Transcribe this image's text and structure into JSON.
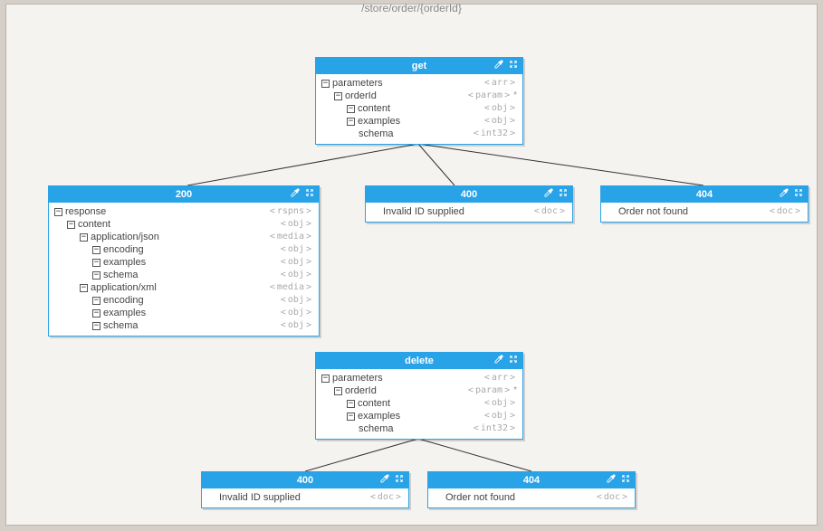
{
  "frameTitle": "/store/order/{orderId}",
  "nodes": {
    "get": {
      "title": "get",
      "rows": [
        {
          "indent": 0,
          "toggle": "-",
          "label": "parameters",
          "type": "arr",
          "star": false
        },
        {
          "indent": 1,
          "toggle": "-",
          "label": "orderId",
          "type": "param",
          "star": true
        },
        {
          "indent": 2,
          "toggle": "-",
          "label": "content",
          "type": "obj",
          "star": false
        },
        {
          "indent": 2,
          "toggle": "-",
          "label": "examples",
          "type": "obj",
          "star": false
        },
        {
          "indent": 2,
          "toggle": "",
          "label": "schema",
          "type": "int32",
          "star": false
        }
      ]
    },
    "r200": {
      "title": "200",
      "rows": [
        {
          "indent": 0,
          "toggle": "-",
          "label": "response",
          "type": "rspns",
          "star": false
        },
        {
          "indent": 1,
          "toggle": "-",
          "label": "content",
          "type": "obj",
          "star": false
        },
        {
          "indent": 2,
          "toggle": "-",
          "label": "application/json",
          "type": "media",
          "star": false
        },
        {
          "indent": 3,
          "toggle": "-",
          "label": "encoding",
          "type": "obj",
          "star": false
        },
        {
          "indent": 3,
          "toggle": "-",
          "label": "examples",
          "type": "obj",
          "star": false
        },
        {
          "indent": 3,
          "toggle": "-",
          "label": "schema",
          "type": "obj",
          "star": false
        },
        {
          "indent": 2,
          "toggle": "-",
          "label": "application/xml",
          "type": "media",
          "star": false
        },
        {
          "indent": 3,
          "toggle": "-",
          "label": "encoding",
          "type": "obj",
          "star": false
        },
        {
          "indent": 3,
          "toggle": "-",
          "label": "examples",
          "type": "obj",
          "star": false
        },
        {
          "indent": 3,
          "toggle": "-",
          "label": "schema",
          "type": "obj",
          "star": false
        }
      ]
    },
    "r400a": {
      "title": "400",
      "rows": [
        {
          "indent": 0,
          "toggle": "",
          "label": "Invalid ID supplied",
          "type": "doc",
          "star": false
        }
      ]
    },
    "r404a": {
      "title": "404",
      "rows": [
        {
          "indent": 0,
          "toggle": "",
          "label": "Order not found",
          "type": "doc",
          "star": false
        }
      ]
    },
    "delete": {
      "title": "delete",
      "rows": [
        {
          "indent": 0,
          "toggle": "-",
          "label": "parameters",
          "type": "arr",
          "star": false
        },
        {
          "indent": 1,
          "toggle": "-",
          "label": "orderId",
          "type": "param",
          "star": true
        },
        {
          "indent": 2,
          "toggle": "-",
          "label": "content",
          "type": "obj",
          "star": false
        },
        {
          "indent": 2,
          "toggle": "-",
          "label": "examples",
          "type": "obj",
          "star": false
        },
        {
          "indent": 2,
          "toggle": "",
          "label": "schema",
          "type": "int32",
          "star": false
        }
      ]
    },
    "r400b": {
      "title": "400",
      "rows": [
        {
          "indent": 0,
          "toggle": "",
          "label": "Invalid ID supplied",
          "type": "doc",
          "star": false
        }
      ]
    },
    "r404b": {
      "title": "404",
      "rows": [
        {
          "indent": 0,
          "toggle": "",
          "label": "Order not found",
          "type": "doc",
          "star": false
        }
      ]
    }
  }
}
